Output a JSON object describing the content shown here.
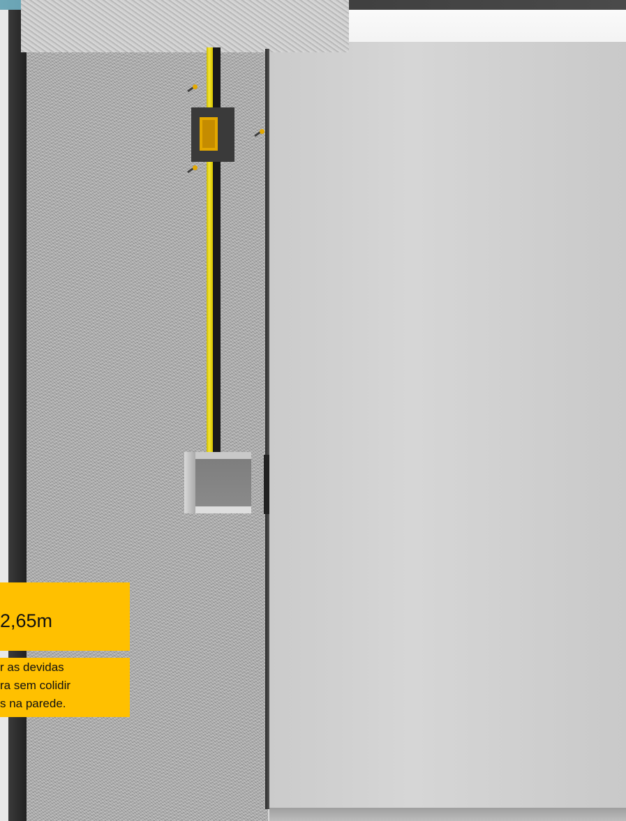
{
  "scene": {
    "colors": {
      "conduit": "#f5e530",
      "note_background": "#ffc000",
      "wall": "#d6d6d6",
      "column": "#a9a9a9"
    },
    "dimension_note": {
      "text": "2,65m"
    },
    "instruction_note": {
      "lines": [
        "r as devidas",
        "ra sem colidir",
        "s na parede."
      ]
    }
  }
}
